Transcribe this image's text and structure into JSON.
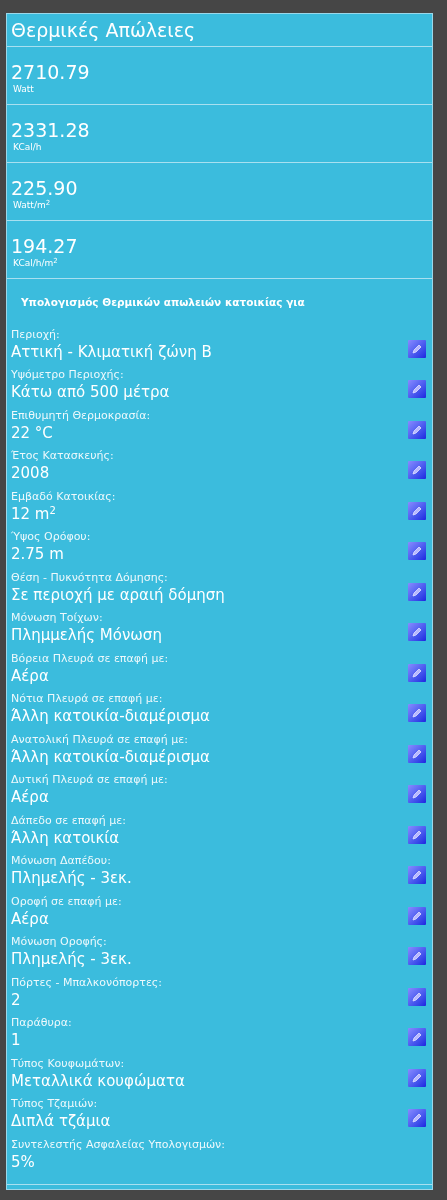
{
  "title": "Θερμικές Απώλειες",
  "stats": [
    {
      "value": "2710.79",
      "unit": "Watt"
    },
    {
      "value": "2331.28",
      "unit": "KCal/h"
    },
    {
      "value": "225.90",
      "unit": "Watt/m$^{2}$"
    },
    {
      "value": "194.27",
      "unit": "KCal/h/m$^{2}$"
    }
  ],
  "heading": "Υπολογισμός Θερμικών απωλειών κατοικίας για",
  "fields": [
    {
      "label": "Περιοχή:",
      "value": "Αττική - Κλιματική ζώνη Β",
      "editable": true
    },
    {
      "label": "Υψόμετρο Περιοχής:",
      "value": "Κάτω από 500 μέτρα",
      "editable": true
    },
    {
      "label": "Επιθυμητή Θερμοκρασία:",
      "value": "22 °C",
      "editable": true
    },
    {
      "label": "Έτος Κατασκευής:",
      "value": "2008",
      "editable": true
    },
    {
      "label": "Εμβαδό Κατοικίας:",
      "value": "12 m$^{2}$",
      "editable": true
    },
    {
      "label": "Ύψος Ορόφου:",
      "value": "2.75 m",
      "editable": true
    },
    {
      "label": "Θέση - Πυκνότητα Δόμησης:",
      "value": "Σε περιοχή με αραιή δόμηση",
      "editable": true
    },
    {
      "label": "Μόνωση Τοίχων:",
      "value": "Πλημμελής Μόνωση",
      "editable": true
    },
    {
      "label": "Βόρεια Πλευρά σε επαφή με:",
      "value": "Αέρα",
      "editable": true
    },
    {
      "label": "Νότια Πλευρά σε επαφή με:",
      "value": "Άλλη κατοικία-διαμέρισμα",
      "editable": true
    },
    {
      "label": "Ανατολική Πλευρά σε επαφή με:",
      "value": "Άλλη κατοικία-διαμέρισμα",
      "editable": true
    },
    {
      "label": "Δυτική Πλευρά σε επαφή με:",
      "value": "Αέρα",
      "editable": true
    },
    {
      "label": "Δάπεδο σε επαφή με:",
      "value": "Άλλη κατοικία",
      "editable": true
    },
    {
      "label": "Μόνωση Δαπέδου:",
      "value": "Πλημελής - 3εκ.",
      "editable": true
    },
    {
      "label": "Οροφή σε επαφή με:",
      "value": "Αέρα",
      "editable": true
    },
    {
      "label": "Μόνωση Οροφής:",
      "value": "Πλημελής - 3εκ.",
      "editable": true
    },
    {
      "label": "Πόρτες - Μπαλκονόπορτες:",
      "value": "2",
      "editable": true
    },
    {
      "label": "Παράθυρα:",
      "value": "1",
      "editable": true
    },
    {
      "label": "Τύπος Κουφωμάτων:",
      "value": "Μεταλλικά κουφώματα",
      "editable": true
    },
    {
      "label": "Τύπος Τζαμιών:",
      "value": "Διπλά τζάμια",
      "editable": true
    },
    {
      "label": "Συντελεστής Ασφαλείας Υπολογισμών:",
      "value": "5%",
      "editable": false
    }
  ]
}
